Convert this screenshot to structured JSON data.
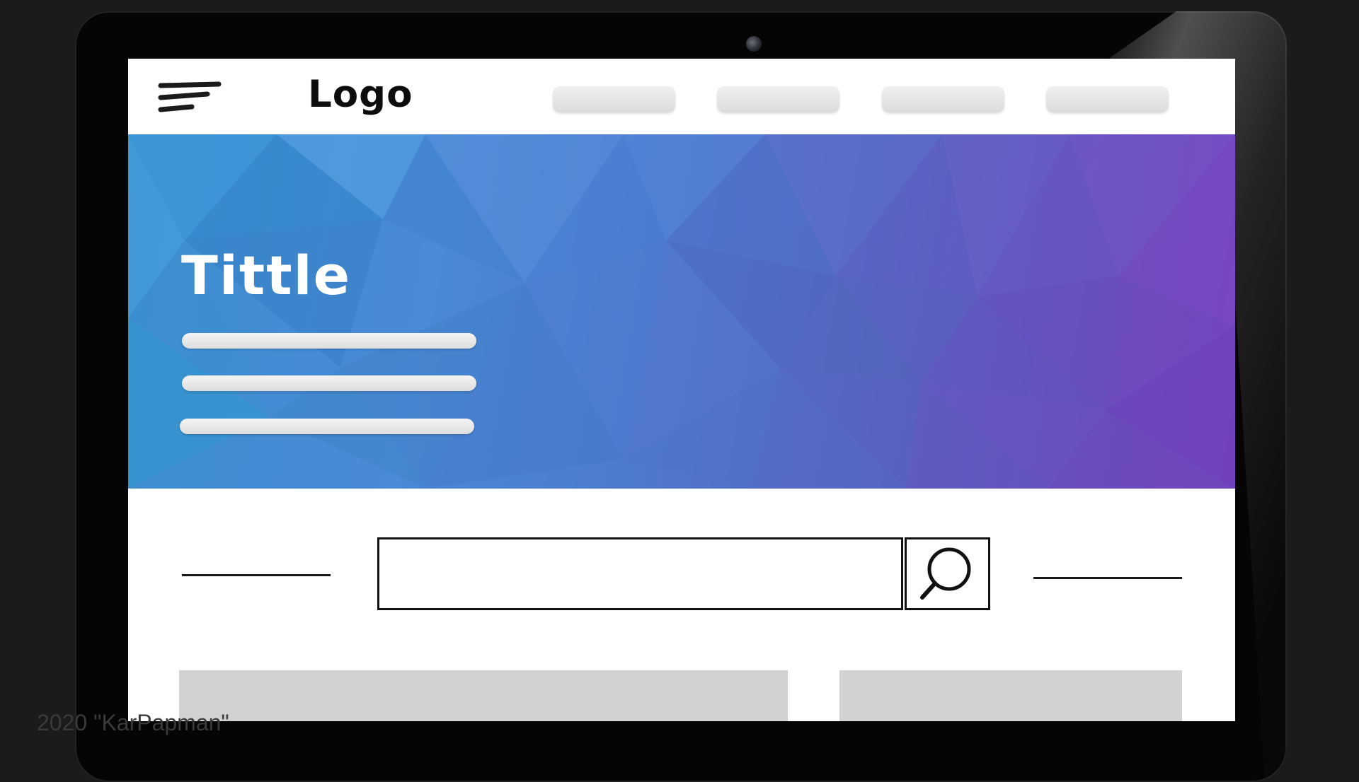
{
  "navbar": {
    "logo_text": "Logo",
    "nav_item_count": 4
  },
  "hero": {
    "title": "Tittle",
    "text_line_count": 3
  },
  "search": {
    "value": "",
    "placeholder": ""
  },
  "watermark": "2020 \"KarPapman\"",
  "colors": {
    "hero_start": "#3b8fcf",
    "hero_end": "#7643c0",
    "card_gray": "#d2d2d4",
    "nav_pill": "#e6e6e6"
  },
  "icons": [
    "menu-icon",
    "search-icon"
  ]
}
